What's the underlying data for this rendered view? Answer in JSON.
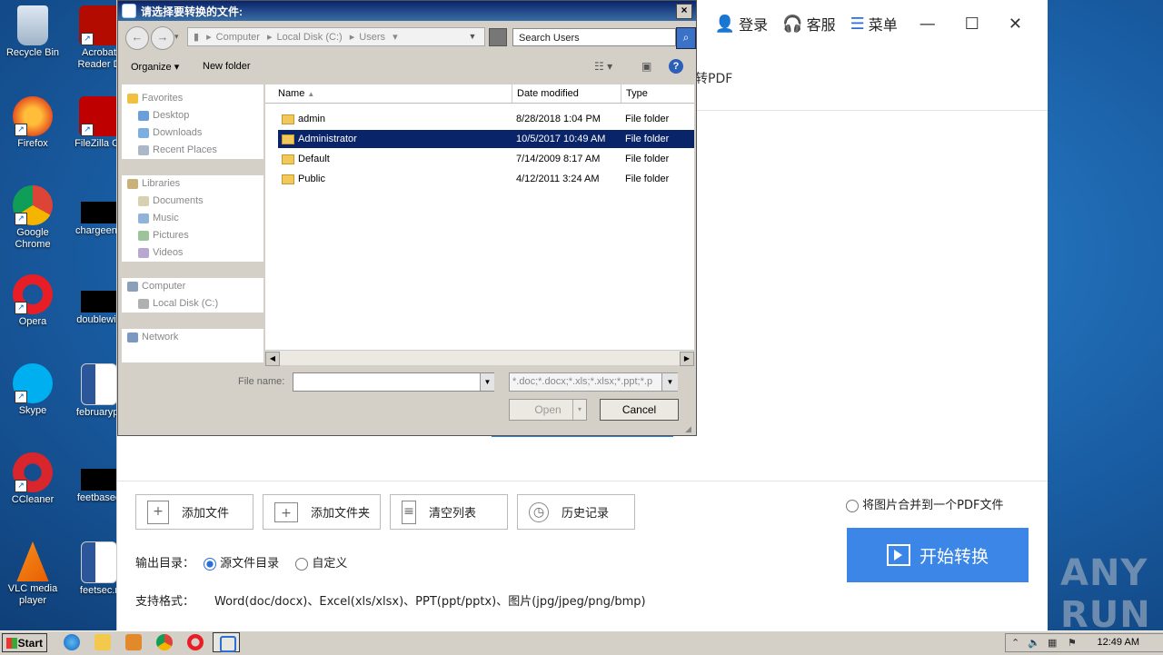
{
  "desktop": {
    "icons": [
      {
        "label": "Recycle Bin"
      },
      {
        "label": "Acrobat Reader D"
      },
      {
        "label": "Firefox"
      },
      {
        "label": "FileZilla Cli"
      },
      {
        "label": "Google Chrome"
      },
      {
        "label": "chargeeng"
      },
      {
        "label": "Opera"
      },
      {
        "label": "doublewid"
      },
      {
        "label": "Skype"
      },
      {
        "label": "februarypr"
      },
      {
        "label": "CCleaner"
      },
      {
        "label": "feetbased"
      },
      {
        "label": "VLC media player"
      },
      {
        "label": "feetsec.r"
      }
    ]
  },
  "app": {
    "login": "登录",
    "service": "客服",
    "menu": "菜单",
    "subtitle": "转PDF",
    "buttons": {
      "add_file": "添加文件",
      "add_folder": "添加文件夹",
      "clear_list": "清空列表",
      "history": "历史记录"
    },
    "merge_images": "将图片合并到一个PDF文件",
    "start": "开始转换",
    "output_dir_label": "输出目录：",
    "output_source": "源文件目录",
    "output_custom": "自定义",
    "formats_label": "支持格式：",
    "formats": "Word(doc/docx)、Excel(xls/xlsx)、PPT(ppt/pptx)、图片(jpg/jpeg/png/bmp)",
    "watermark": "ANY RUN"
  },
  "dialog": {
    "title": "请选择要转换的文件:",
    "address": [
      "Computer",
      "Local Disk (C:)",
      "Users"
    ],
    "search_placeholder": "Search Users",
    "organize": "Organize",
    "new_folder": "New folder",
    "nav": {
      "favorites": "Favorites",
      "desktop": "Desktop",
      "downloads": "Downloads",
      "recent": "Recent Places",
      "libraries": "Libraries",
      "documents": "Documents",
      "music": "Music",
      "pictures": "Pictures",
      "videos": "Videos",
      "computer": "Computer",
      "local_disk": "Local Disk (C:)",
      "network": "Network"
    },
    "columns": {
      "name": "Name",
      "date": "Date modified",
      "type": "Type"
    },
    "files": [
      {
        "name": "admin",
        "date": "8/28/2018 1:04 PM",
        "type": "File folder"
      },
      {
        "name": "Administrator",
        "date": "10/5/2017 10:49 AM",
        "type": "File folder"
      },
      {
        "name": "Default",
        "date": "7/14/2009 8:17 AM",
        "type": "File folder"
      },
      {
        "name": "Public",
        "date": "4/12/2011 3:24 AM",
        "type": "File folder"
      }
    ],
    "selected_index": 1,
    "file_name_label": "File name:",
    "file_name_value": "",
    "filter": "*.doc;*.docx;*.xls;*.xlsx;*.ppt;*.p",
    "open": "Open",
    "cancel": "Cancel"
  },
  "taskbar": {
    "start": "Start",
    "clock": "12:49 AM"
  }
}
